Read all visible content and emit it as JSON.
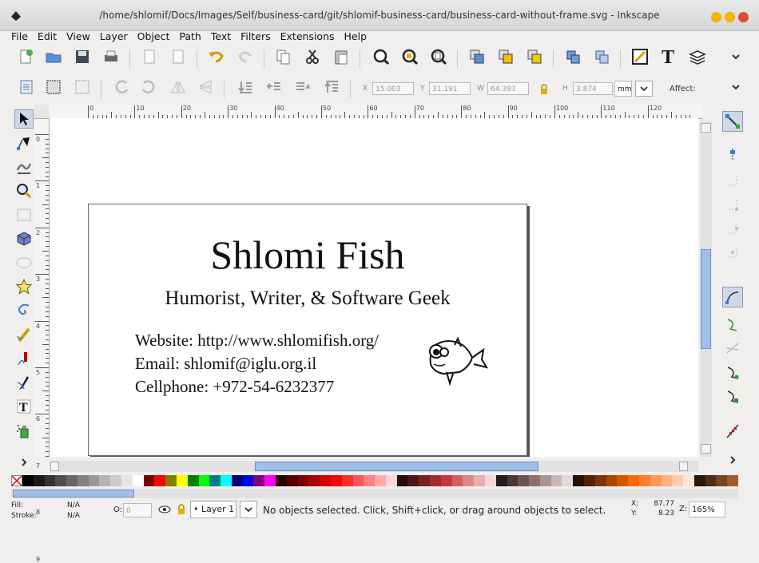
{
  "window": {
    "title": "/home/shlomif/Docs/Images/Self/business-card/git/shlomif-business-card/business-card-without-frame.svg - Inkscape"
  },
  "menu": [
    "File",
    "Edit",
    "View",
    "Layer",
    "Object",
    "Path",
    "Text",
    "Filters",
    "Extensions",
    "Help"
  ],
  "toolbar2": {
    "x_label": "X",
    "x_value": "15.003",
    "y_label": "Y",
    "y_value": "31.191",
    "w_label": "W",
    "w_value": "64.393",
    "h_label": "H",
    "h_value": "3.874",
    "unit": "mm",
    "affect_label": "Affect:"
  },
  "ruler": {
    "h_ticks": [
      "0",
      "10",
      "20",
      "30",
      "40",
      "50",
      "60",
      "70",
      "80",
      "90",
      "100",
      "110",
      "120"
    ],
    "v_ticks": [
      "0",
      "1",
      "2",
      "3",
      "4",
      "5",
      "6",
      "7",
      "8",
      "9"
    ]
  },
  "card": {
    "name": "Shlomi Fish",
    "tagline": "Humorist, Writer, & Software Geek",
    "website": "Website: http://www.shlomifish.org/",
    "email": "Email: shlomif@iglu.org.il",
    "phone": "Cellphone: +972-54-6232377"
  },
  "palette": [
    "#000000",
    "#1a1a1a",
    "#333333",
    "#4d4d4d",
    "#666666",
    "#808080",
    "#999999",
    "#b3b3b3",
    "#cccccc",
    "#e6e6e6",
    "#ffffff",
    "#800000",
    "#ff0000",
    "#808000",
    "#ffff00",
    "#008000",
    "#00ff00",
    "#008080",
    "#00ffff",
    "#000080",
    "#0000ff",
    "#800080",
    "#ff00ff",
    "#2b0000",
    "#550000",
    "#800000",
    "#aa0000",
    "#d40000",
    "#ff0000",
    "#ff2a2a",
    "#ff5555",
    "#ff8080",
    "#ffaaaa",
    "#ffd5d5",
    "#280b0b",
    "#501616",
    "#782121",
    "#a02c2c",
    "#c83737",
    "#d35f5f",
    "#de8787",
    "#e9afaf",
    "#f4d7d7",
    "#241c1c",
    "#483737",
    "#6c5353",
    "#916f6f",
    "#ac9393",
    "#c8b7b7",
    "#e3dbdb",
    "#2b1100",
    "#552200",
    "#803300",
    "#aa4400",
    "#d45500",
    "#ff6600",
    "#ff7f2a",
    "#ff9955",
    "#ffb380",
    "#ffccaa",
    "#ffe6d5",
    "#28170b",
    "#502d16",
    "#784421",
    "#a05a2c"
  ],
  "status": {
    "fill_label": "Fill:",
    "fill_value": "N/A",
    "stroke_label": "Stroke:",
    "stroke_value": "N/A",
    "opacity_label": "O:",
    "opacity_value": "0",
    "layer": "Layer 1",
    "message": "No objects selected. Click, Shift+click, or drag around objects to select.",
    "x_label": "X:",
    "x_value": "87.77",
    "y_label": "Y:",
    "y_value": "8.23",
    "zoom_label": "Z:",
    "zoom_value": "165%"
  }
}
